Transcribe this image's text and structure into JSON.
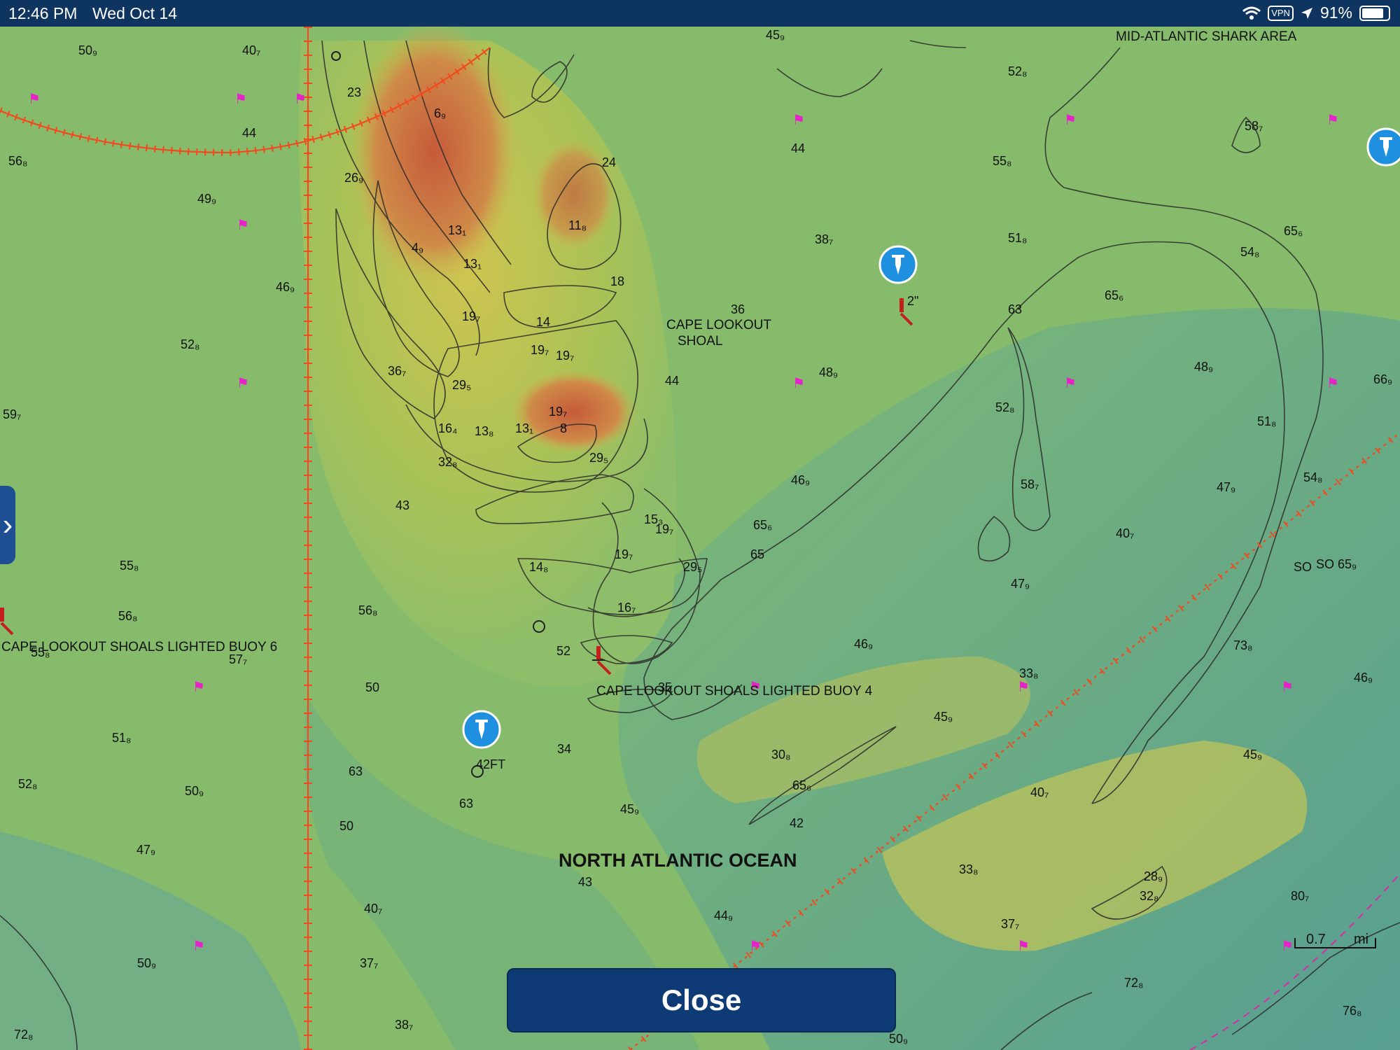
{
  "status_bar": {
    "time": "12:46 PM",
    "date": "Wed Oct 14",
    "vpn": "VPN",
    "battery": "91%",
    "icons": [
      "wifi-icon",
      "location-arrow-icon",
      "battery-icon"
    ]
  },
  "map": {
    "labels": {
      "shark_area": "MID-ATLANTIC SHARK AREA",
      "shoal_1": "CAPE LOOKOUT",
      "shoal_2": "SHOAL",
      "buoy_6": "CAPE LOOKOUT SHOALS LIGHTED BUOY 6",
      "buoy_4": "CAPE LOOKOUT SHOALS LIGHTED BUOY 4",
      "ocean": "NORTH ATLANTIC OCEAN",
      "so": "SO",
      "waypoint_depth_1": "2\"",
      "waypoint_depth_2": "42FT"
    },
    "soundings": [
      "50₉",
      "40₇",
      "45₉",
      "52₈",
      "23",
      "6₉",
      "44",
      "56₈",
      "26₉",
      "49₉",
      "24",
      "44",
      "55₈",
      "58₇",
      "13₁",
      "4₉",
      "11₈",
      "13₁",
      "38₇",
      "51₈",
      "65₆",
      "54₈",
      "18",
      "46₉",
      "63",
      "65₆",
      "36",
      "52₈",
      "19₇",
      "14",
      "19₇",
      "19₇",
      "36₇",
      "48₉",
      "48₉",
      "66₉",
      "29₅",
      "44",
      "52₈",
      "59₇",
      "19₇",
      "16₄",
      "13₈",
      "13₁",
      "8",
      "51₈",
      "29₅",
      "54₈",
      "32₈",
      "46₉",
      "58₇",
      "47₉",
      "43",
      "15₃",
      "19₇",
      "65₆",
      "40₇",
      "14₈",
      "19₇",
      "29₅",
      "65",
      "SO 65₉",
      "55₈",
      "47₉",
      "56₈",
      "56₈",
      "16₇",
      "73₈",
      "46₉",
      "52",
      "33₈",
      "55₈",
      "57₇",
      "35",
      "46₉",
      "50",
      "51₈",
      "45₉",
      "30₈",
      "45₉",
      "34",
      "65₆",
      "40₇",
      "52₈",
      "50₉",
      "63",
      "63",
      "45₉",
      "42",
      "50",
      "47₉",
      "33₈",
      "28₉",
      "32₈",
      "43",
      "80₇",
      "40₇",
      "44₉",
      "37₇",
      "50₉",
      "37₇",
      "72₈",
      "38₇",
      "76₈",
      "72₈",
      "50₉"
    ],
    "scale": {
      "value": "0.7",
      "unit": "mi"
    },
    "colors": {
      "deep_water": "#5fa69a",
      "mid_water": "#8fbe6a",
      "shallow": "#c9c24e",
      "very_shallow": "#c8643a",
      "contour": "#2a2a2a",
      "boundary_line": "#f04a1e",
      "bird_marker": "#e623c8",
      "waypoint": "#1f8fe0"
    }
  },
  "close_button": {
    "label": "Close"
  }
}
